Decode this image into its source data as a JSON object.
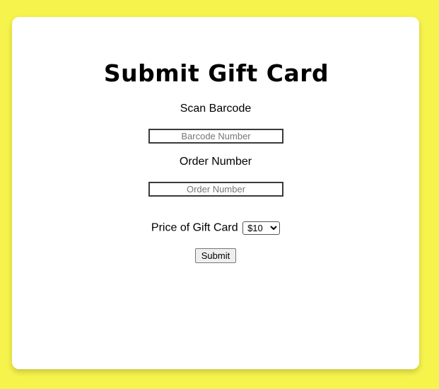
{
  "page": {
    "background_color": "#f6f34c",
    "card_color": "#ffffff"
  },
  "form": {
    "title": "Submit Gift Card",
    "barcode": {
      "label": "Scan Barcode",
      "placeholder": "Barcode Number",
      "value": ""
    },
    "order": {
      "label": "Order Number",
      "placeholder": "Order Number",
      "value": ""
    },
    "price": {
      "label": "Price of Gift Card",
      "selected": "$10"
    },
    "submit_label": "Submit"
  }
}
